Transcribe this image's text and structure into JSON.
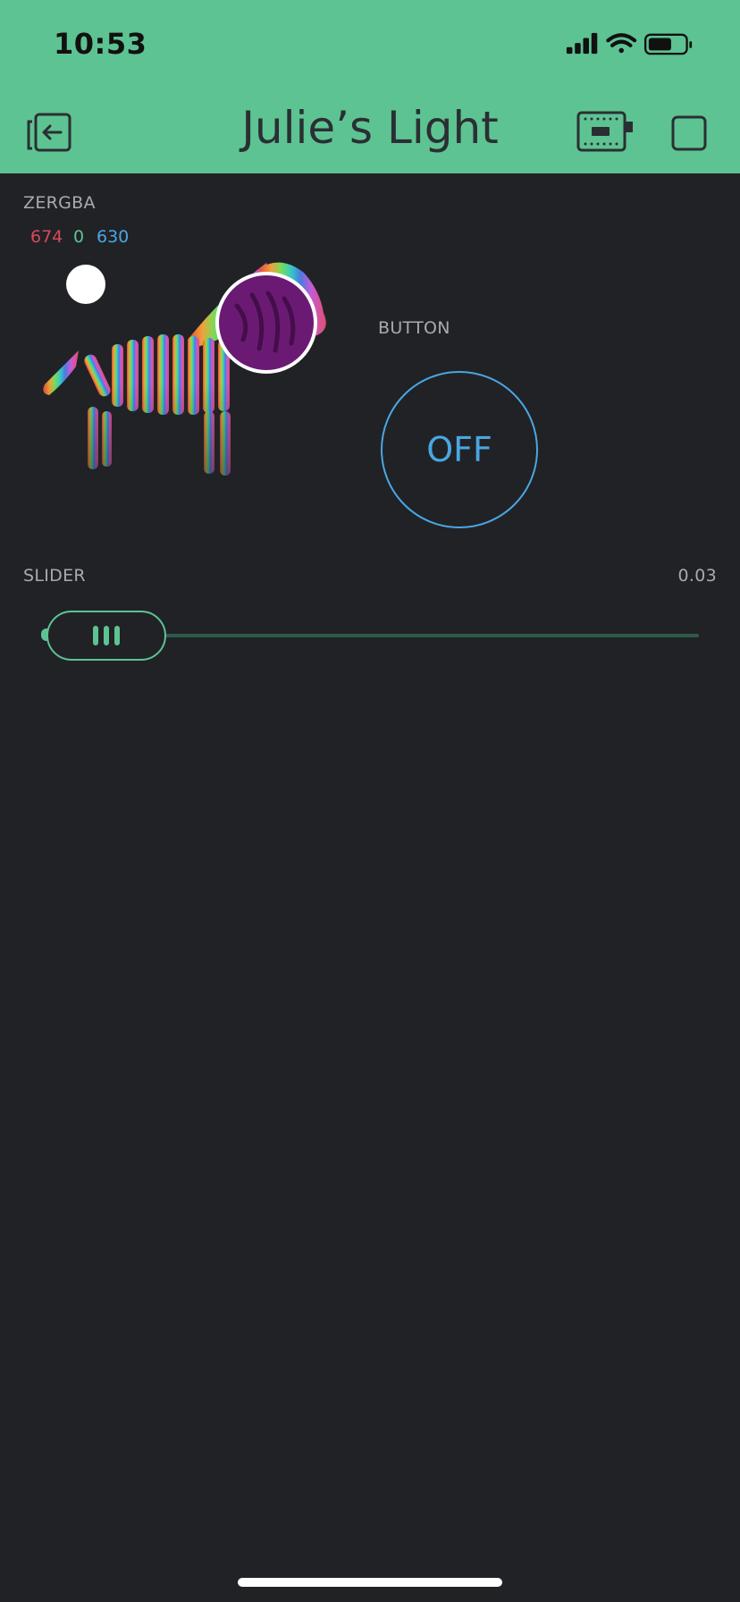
{
  "status_bar": {
    "time": "10:53"
  },
  "header": {
    "title": "Julie’s Light"
  },
  "zergba": {
    "label": "ZERGBA",
    "r": "674",
    "g": "0",
    "b": "630",
    "colors": {
      "r": "#d9485e",
      "g": "#5dc392",
      "b": "#4aa6e2",
      "selected": "#6b1a74"
    }
  },
  "button": {
    "label": "BUTTON",
    "state": "OFF"
  },
  "slider": {
    "label": "SLIDER",
    "value_text": "0.03",
    "value": 0.03
  },
  "colors": {
    "accent": "#5dc392",
    "background": "#212226",
    "button_blue": "#4aa6e2"
  }
}
